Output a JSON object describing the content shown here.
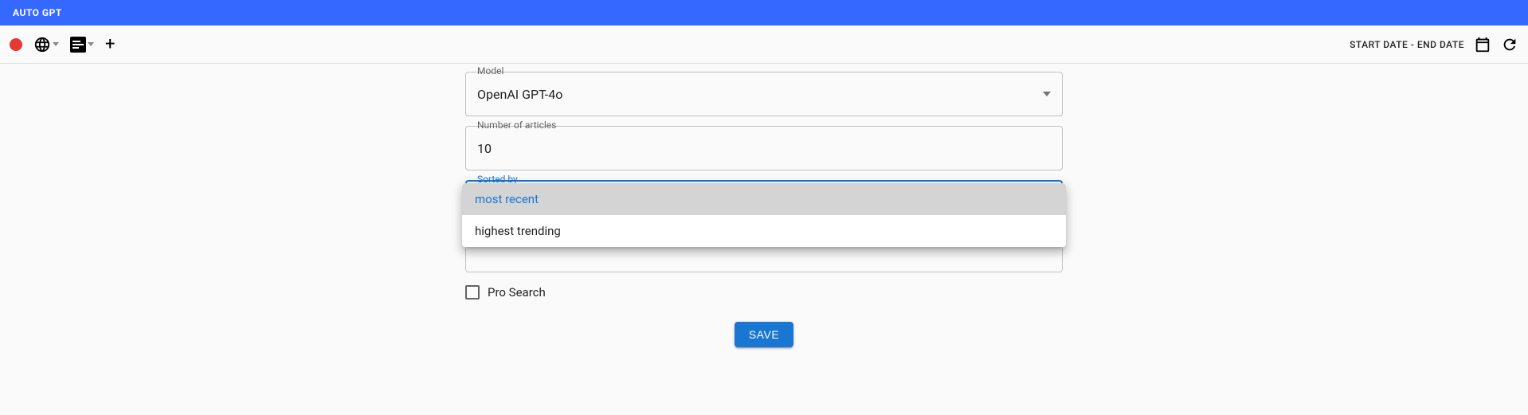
{
  "header": {
    "title": "AUTO GPT"
  },
  "toolbar": {
    "date_range_label": "START DATE - END DATE"
  },
  "form": {
    "model": {
      "label": "Model",
      "value": "OpenAI GPT-4o"
    },
    "num_articles": {
      "label": "Number of articles",
      "value": "10"
    },
    "sorted_by": {
      "label": "Sorted by",
      "options": [
        "most recent",
        "highest trending"
      ],
      "selected": "most recent"
    },
    "pro_search": {
      "label": "Pro Search",
      "checked": false
    },
    "save_label": "SAVE"
  }
}
